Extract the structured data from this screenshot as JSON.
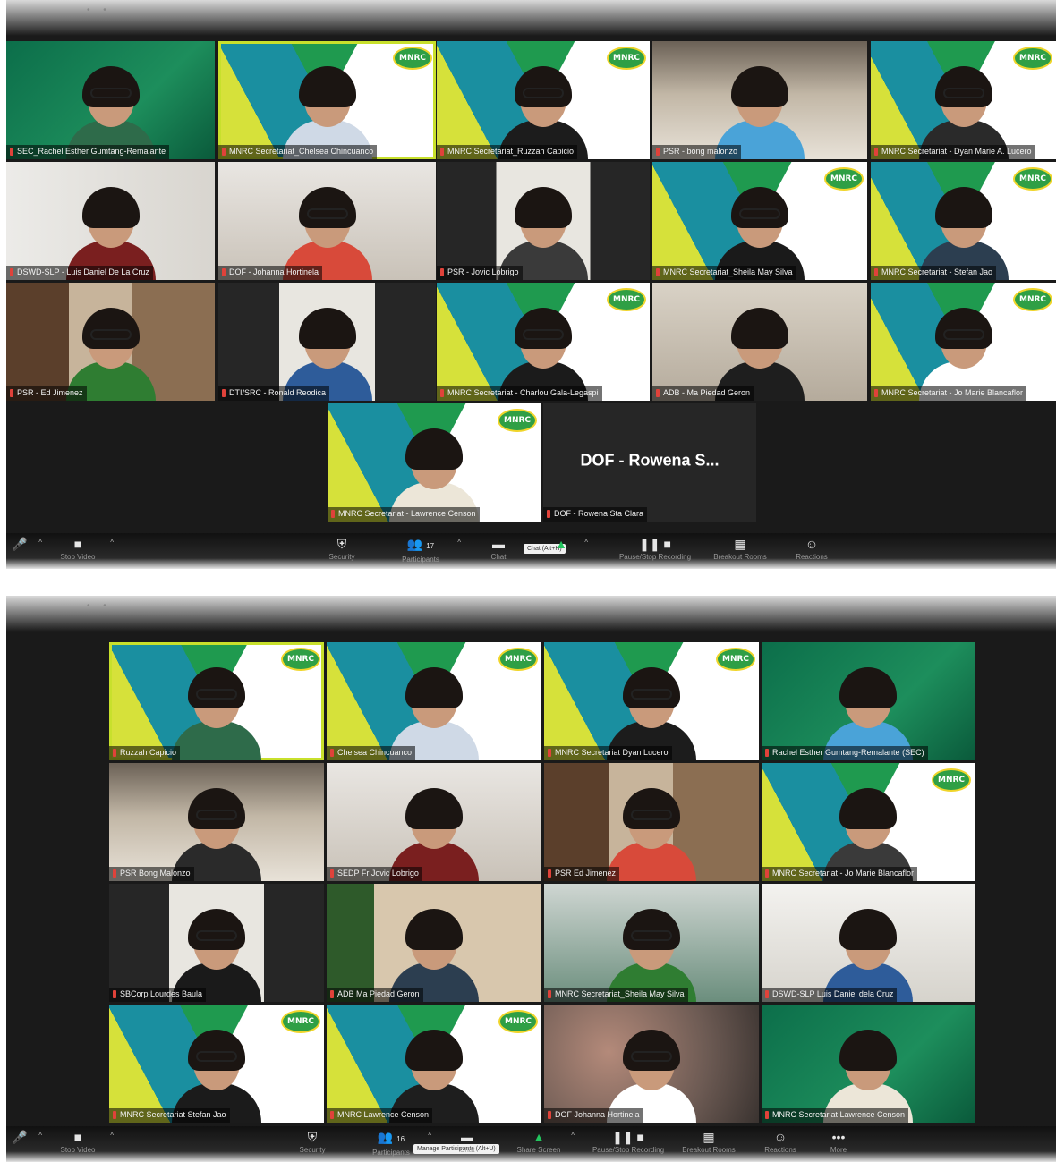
{
  "top_meeting": {
    "participants": [
      {
        "name": "SEC_Rachel Esther Gumtang-Remalante",
        "bg": "green"
      },
      {
        "name": "MNRC Secretariat_Chelsea Chincuanco",
        "bg": "mnrc",
        "active": true
      },
      {
        "name": "MNRC Secretariat_Ruzzah Capicio",
        "bg": "mnrc"
      },
      {
        "name": "PSR - bong malonzo",
        "bg": "room1"
      },
      {
        "name": "MNRC Secretariat - Dyan Marie A. Lucero",
        "bg": "mnrc"
      },
      {
        "name": "DSWD-SLP - Luis Daniel De La Cruz",
        "bg": "room2"
      },
      {
        "name": "DOF - Johanna Hortinela",
        "bg": "room3"
      },
      {
        "name": "PSR - Jovic Lobrigo",
        "bg": "pillar"
      },
      {
        "name": "MNRC Secretariat_Sheila May Silva",
        "bg": "mnrc"
      },
      {
        "name": "MNRC Secretariat - Stefan Jao",
        "bg": "mnrc"
      },
      {
        "name": "PSR - Ed Jimenez",
        "bg": "shelf"
      },
      {
        "name": "DTI/SRC - Ronald Reodica",
        "bg": "pillar"
      },
      {
        "name": "MNRC Secretariat - Charlou Gala-Legaspi",
        "bg": "mnrc"
      },
      {
        "name": "ADB - Ma Piedad Geron",
        "bg": "office"
      },
      {
        "name": "MNRC Secretariat - Jo Marie Blancaflor",
        "bg": "mnrc"
      },
      {
        "name": "MNRC Secretariat - Lawrence Censon",
        "bg": "mnrc"
      },
      {
        "name": "DOF - Rowena Sta Clara",
        "bg": "dark",
        "video_off_label": "DOF - Rowena S..."
      }
    ],
    "toolbar": {
      "unmute": "Unmute",
      "stop_video": "Stop Video",
      "security": "Security",
      "participants": "Participants",
      "participants_count": "17",
      "chat": "Chat",
      "chat_tooltip": "Chat (Alt+H)",
      "share_screen": "Share Screen",
      "recording": "Pause/Stop Recording",
      "breakout_rooms": "Breakout Rooms",
      "reactions": "Reactions"
    }
  },
  "bottom_meeting": {
    "participants": [
      {
        "name": "Ruzzah Capicio",
        "bg": "mnrc",
        "active": true
      },
      {
        "name": "Chelsea Chincuanco",
        "bg": "mnrc"
      },
      {
        "name": "MNRC Secretariat Dyan Lucero",
        "bg": "mnrc"
      },
      {
        "name": "Rachel Esther Gumtang-Remalante (SEC)",
        "bg": "green"
      },
      {
        "name": "PSR Bong Malonzo",
        "bg": "room1"
      },
      {
        "name": "SEDP Fr Jovic Lobrigo",
        "bg": "room3"
      },
      {
        "name": "PSR Ed Jimenez",
        "bg": "shelf"
      },
      {
        "name": "MNRC Secretariat - Jo Marie Blancaflor",
        "bg": "mnrc"
      },
      {
        "name": "SBCorp Lourdes Baula",
        "bg": "pillar"
      },
      {
        "name": "ADB Ma Piedad Geron",
        "bg": "xmas"
      },
      {
        "name": "MNRC Secretariat_Sheila May Silva",
        "bg": "work"
      },
      {
        "name": "DSWD-SLP Luis Daniel dela Cruz",
        "bg": "lightroom"
      },
      {
        "name": "MNRC Secretariat Stefan Jao",
        "bg": "mnrc"
      },
      {
        "name": "MNRC Lawrence Censon",
        "bg": "mnrc"
      },
      {
        "name": "DOF Johanna Hortinela",
        "bg": "blur"
      },
      {
        "name": "MNRC Secretariat Lawrence Censon",
        "bg": "green"
      }
    ],
    "toolbar": {
      "unmute": "Unmute",
      "stop_video": "Stop Video",
      "security": "Security",
      "participants": "Participants",
      "participants_count": "16",
      "participants_tooltip": "Manage Participants (Alt+U)",
      "chat": "Chat",
      "share_screen": "Share Screen",
      "recording": "Pause/Stop Recording",
      "breakout_rooms": "Breakout Rooms",
      "reactions": "Reactions",
      "more": "More"
    }
  },
  "logo_text": "MNRC",
  "colors": {
    "active_border": "#c8e02c",
    "name_marker": "#e0423a",
    "share_green": "#22c55e",
    "mnrc_green": "#1f9a4f",
    "mnrc_teal": "#1a8fa0",
    "mnrc_yellow": "#d6e13a"
  }
}
